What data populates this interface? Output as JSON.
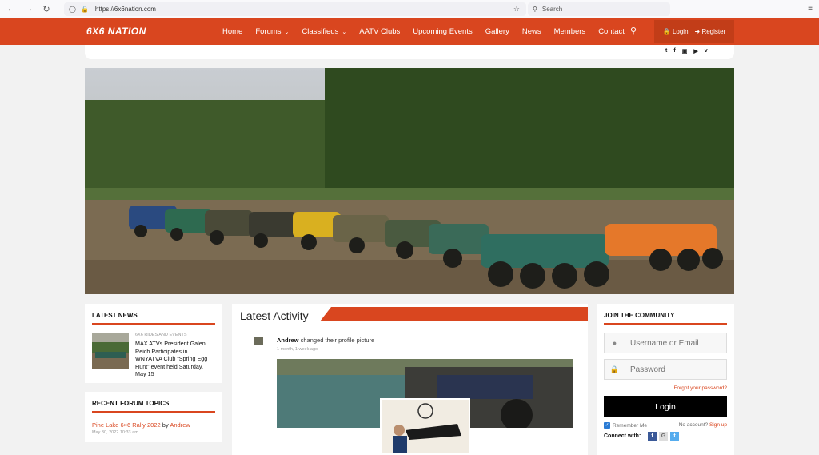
{
  "browser": {
    "url": "https://6x6nation.com",
    "search_placeholder": "Search"
  },
  "site": {
    "logo": "6X6 NATION",
    "nav": [
      {
        "label": "Home",
        "dropdown": false
      },
      {
        "label": "Forums",
        "dropdown": true
      },
      {
        "label": "Classifieds",
        "dropdown": true
      },
      {
        "label": "AATV Clubs",
        "dropdown": false
      },
      {
        "label": "Upcoming Events",
        "dropdown": false
      },
      {
        "label": "Gallery",
        "dropdown": false
      },
      {
        "label": "News",
        "dropdown": false
      },
      {
        "label": "Members",
        "dropdown": false
      },
      {
        "label": "Contact",
        "dropdown": false
      }
    ],
    "login_label": "Login",
    "register_label": "Register",
    "social": [
      "twitter-icon",
      "facebook-icon",
      "instagram-icon",
      "youtube-icon",
      "vimeo-icon"
    ],
    "accent_color": "#d9461f"
  },
  "latest_news": {
    "title": "LATEST NEWS",
    "item": {
      "category": "6X6 RIDES AND EVENTS",
      "headline": "MAX ATVs President Galen Reich Participates in WNYATVA Club “Spring Egg Hunt” event held Saturday, May 15"
    }
  },
  "recent_topics": {
    "title": "RECENT FORUM TOPICS",
    "item": {
      "topic": "Pine Lake 6×6 Rally 2022",
      "by": "by",
      "author": "Andrew",
      "date": "May 30, 2022 10:33 am"
    }
  },
  "activity": {
    "title": "Latest Activity",
    "user": "Andrew",
    "action": "changed their profile picture",
    "time": "1 month, 1 week ago"
  },
  "community": {
    "title": "JOIN THE COMMUNITY",
    "username_placeholder": "Username or Email",
    "password_placeholder": "Password",
    "forgot": "Forgot your password?",
    "login_button": "Login",
    "remember": "Remember Me",
    "no_account": "No account?",
    "signup": "Sign up",
    "connect_with": "Connect with:",
    "connect_buttons": [
      {
        "icon": "facebook-icon",
        "letter": "f",
        "color": "#3b5998"
      },
      {
        "icon": "google-icon",
        "letter": "G",
        "color": "#dddddd"
      },
      {
        "icon": "twitter-icon",
        "letter": "t",
        "color": "#55acee"
      }
    ]
  }
}
